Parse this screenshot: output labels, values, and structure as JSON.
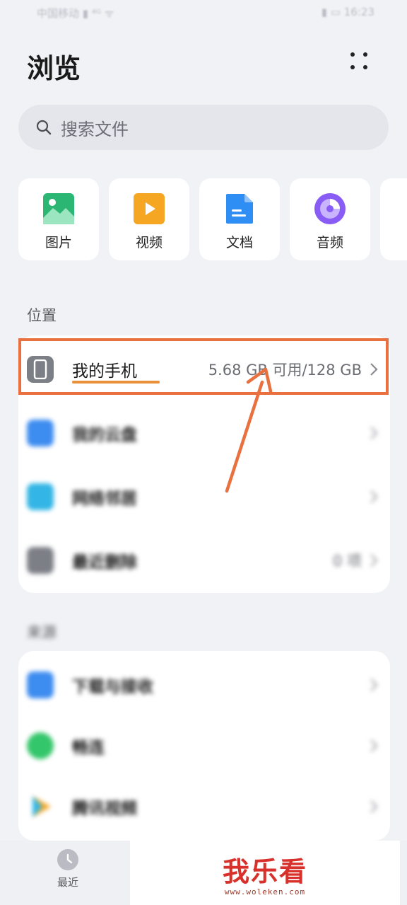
{
  "status_bar": {
    "left": "中国移动 ▮ ⁴ᴳ ᯤ",
    "right": "▮ ▭ 16:23"
  },
  "header": {
    "title": "浏览",
    "more_icon": "more-dots-icon"
  },
  "search": {
    "placeholder": "搜索文件",
    "icon": "search-icon"
  },
  "categories": [
    {
      "label": "图片",
      "icon": "image-icon",
      "color": "#2bb673"
    },
    {
      "label": "视频",
      "icon": "video-icon",
      "color": "#f5a623"
    },
    {
      "label": "文档",
      "icon": "document-icon",
      "color": "#2f8ef4"
    },
    {
      "label": "音频",
      "icon": "audio-icon",
      "color": "#8a5cf6"
    }
  ],
  "locations": {
    "label": "位置",
    "items": [
      {
        "name": "我的手机",
        "sub": "5.68 GB 可用/128 GB",
        "icon": "phone-icon",
        "color": "#7c7f86"
      },
      {
        "name": "我的云盘",
        "sub": "",
        "icon": "cloud-icon",
        "color": "#3d8cf0"
      },
      {
        "name": "网络邻居",
        "sub": "",
        "icon": "network-icon",
        "color": "#33b5e5"
      },
      {
        "name": "最近删除",
        "sub": "0 项",
        "icon": "trash-icon",
        "color": "#7c7f86"
      }
    ]
  },
  "sources": {
    "label": "来源",
    "items": [
      {
        "name": "下载与接收",
        "icon": "download-icon",
        "color": "#3d8cf0"
      },
      {
        "name": "畅连",
        "icon": "chat-icon",
        "color": "#34c66b"
      },
      {
        "name": "腾讯视频",
        "icon": "tencent-video-icon",
        "color": "#f5a623"
      }
    ]
  },
  "tabbar": {
    "recent_label": "最近",
    "recent_icon": "clock-icon"
  },
  "watermark": {
    "text": "我乐看",
    "url": "www.woleken.com"
  },
  "annotation_color": "#e8713f"
}
